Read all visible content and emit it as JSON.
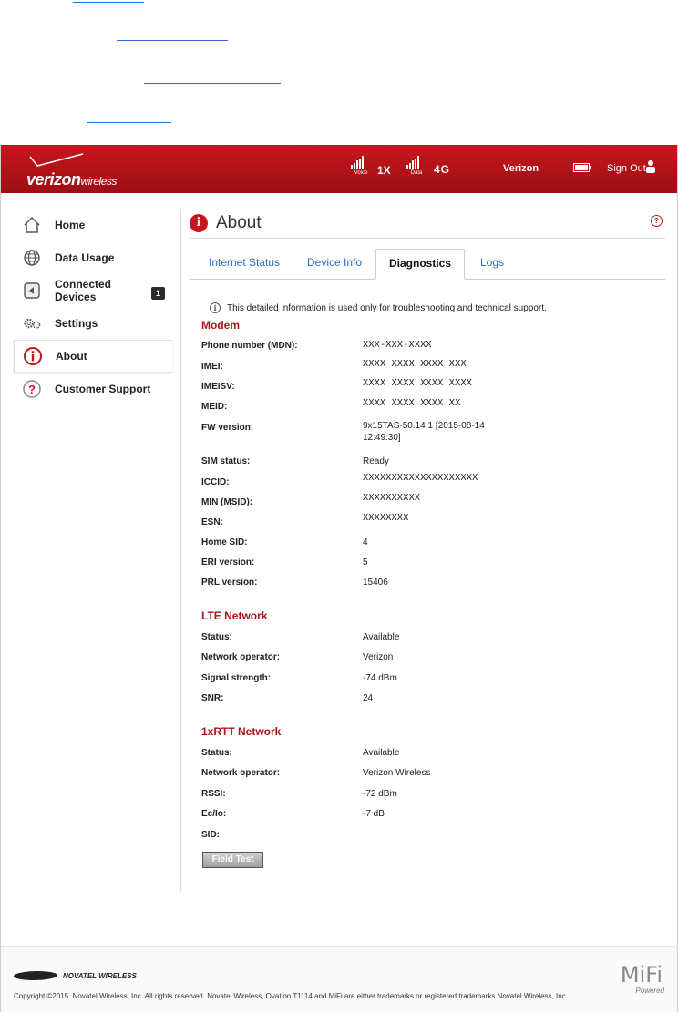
{
  "header": {
    "brand": "verizon",
    "brand_suffix": "wireless",
    "voice_label": "Voice",
    "voice_tech": "1X",
    "data_label": "Data",
    "data_tech": "4G",
    "carrier": "Verizon",
    "sign_out": "Sign Out"
  },
  "sidebar": {
    "items": [
      {
        "label": "Home",
        "icon": "home-icon"
      },
      {
        "label": "Data Usage",
        "icon": "globe-icon"
      },
      {
        "label": "Connected",
        "label2": "Devices",
        "icon": "devices-icon",
        "badge": "1"
      },
      {
        "label": "Settings",
        "icon": "gears-icon"
      },
      {
        "label": "About",
        "icon": "info-icon",
        "active": true
      },
      {
        "label": "Customer Support",
        "icon": "support-icon"
      }
    ]
  },
  "page": {
    "title": "About",
    "tabs": [
      "Internet Status",
      "Device Info",
      "Diagnostics",
      "Logs"
    ],
    "active_tab": "Diagnostics",
    "info_text": "This detailed information is used only for troubleshooting and technical support."
  },
  "modem": {
    "heading": "Modem",
    "rows": [
      {
        "label": "Phone number (MDN):",
        "value": "XXX-XXX-XXXX"
      },
      {
        "label": "IMEI:",
        "value": "XXXX XXXX XXXX XXX"
      },
      {
        "label": "IMEISV:",
        "value": "XXXX XXXX XXXX XXXX"
      },
      {
        "label": "MEID:",
        "value": "XXXX XXXX XXXX XX"
      },
      {
        "label": "FW version:",
        "value": "9x15TAS-50.14 1 [2015-08-14 12:49:30]"
      },
      {
        "label": "SIM status:",
        "value": "Ready"
      },
      {
        "label": "ICCID:",
        "value": "XXXXXXXXXXXXXXXXXXXX"
      },
      {
        "label": "MIN (MSID):",
        "value": "XXXXXXXXXX"
      },
      {
        "label": "ESN:",
        "value": "XXXXXXXX"
      },
      {
        "label": "Home SID:",
        "value": "4"
      },
      {
        "label": "ERI version:",
        "value": "5"
      },
      {
        "label": "PRL version:",
        "value": "15406"
      }
    ]
  },
  "lte": {
    "heading": "LTE Network",
    "rows": [
      {
        "label": "Status:",
        "value": "Available"
      },
      {
        "label": "Network operator:",
        "value": "Verizon"
      },
      {
        "label": "Signal strength:",
        "value": "-74 dBm"
      },
      {
        "label": "SNR:",
        "value": "24"
      }
    ]
  },
  "rtt": {
    "heading": "1xRTT Network",
    "rows": [
      {
        "label": "Status:",
        "value": "Available"
      },
      {
        "label": "Network operator:",
        "value": "Verizon Wireless"
      },
      {
        "label": "RSSI:",
        "value": "-72 dBm"
      },
      {
        "label": "Ec/Io:",
        "value": "-7 dB"
      },
      {
        "label": "SID:",
        "value": ""
      }
    ]
  },
  "field_test_button": "Field Test",
  "footer": {
    "novatel": "NOVATEL WIRELESS",
    "copyright": "Copyright ©2015. Novatel Wireless, Inc. All rights reserved. Novatel Wireless, Ovation T1114 and MiFi are either trademarks or registered trademarks Novatel Wireless, Inc.",
    "mifi": "MiFi",
    "powered": "Powered"
  },
  "colors": {
    "brand_red": "#c8161d",
    "link_blue": "#2b6ec9",
    "section_red": "#b1121a"
  }
}
